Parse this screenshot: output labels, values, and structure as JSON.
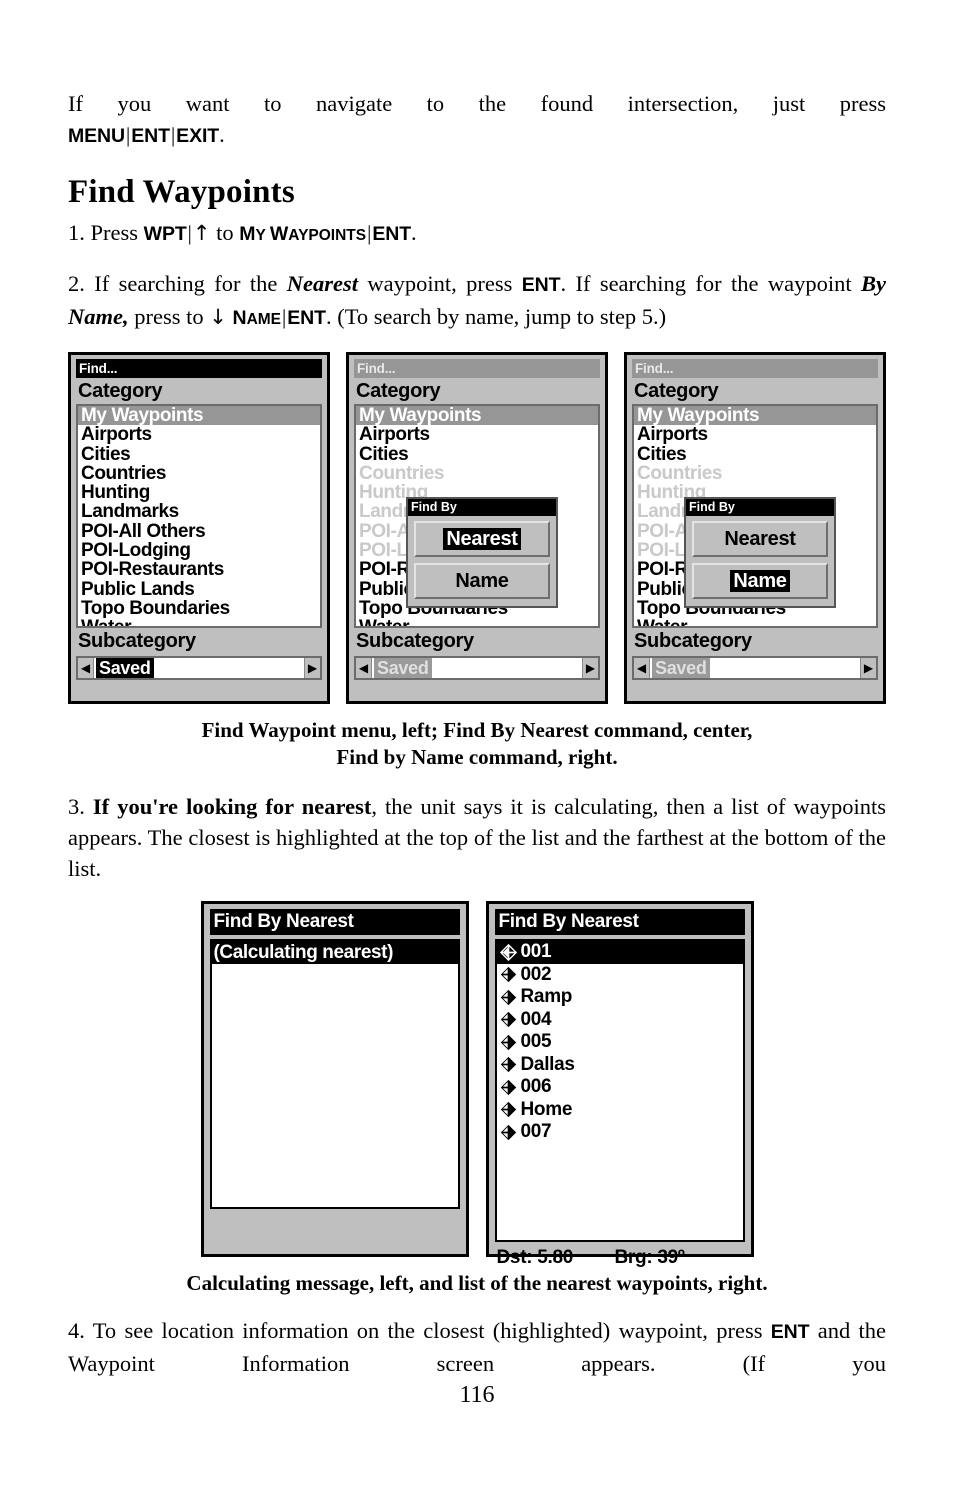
{
  "page": {
    "number": "116"
  },
  "intro": {
    "line_a": "If you want to navigate to the found intersection, just press",
    "key_menu": "MENU",
    "key_ent": "ENT",
    "key_exit": "EXIT",
    "sep": "|",
    "period": "."
  },
  "heading": "Find Waypoints",
  "step1": {
    "num": "1. Press",
    "key_wpt": "WPT",
    "arrow_up": "↑",
    "to": "to",
    "my_waypoints_cap": "M",
    "my_waypoints_rest": "Y ",
    "waypoints_cap": "W",
    "waypoints_rest": "AYPOINTS",
    "key_ent": "ENT",
    "period": "."
  },
  "step2": {
    "t1": "2. If searching for the ",
    "nearest": "Nearest",
    "t2": " waypoint, press ",
    "ent1": "ENT",
    "t3": ". If searching for the waypoint ",
    "byname": "By Name,",
    "t4": " press to ",
    "arrow_down": "↓",
    "name_cap": "N",
    "name_rest": "AME",
    "ent2": "ENT",
    "t5": ". (To search by name, jump to step 5.)"
  },
  "step3": {
    "num": "3. ",
    "bold": "If you're looking for nearest",
    "rest": ", the unit says it is calculating, then a list of waypoints appears. The closest is highlighted at the top of the list and the farthest at the bottom of the list."
  },
  "step4": {
    "t1": "4. To see location information on the closest (highlighted) waypoint, press ",
    "ent": "ENT",
    "t2": " and the Waypoint Information screen appears. (If you"
  },
  "caption1": {
    "line1": "Find Waypoint menu, left; Find By Nearest command, center,",
    "line2": "Find by Name command, right."
  },
  "caption2": "Calculating message, left, and list of the nearest waypoints, right.",
  "find_screen": {
    "title": "Find...",
    "category_label": "Category",
    "subcategory_label": "Subcategory",
    "subcategory_value": "Saved",
    "left_arrow": "◀",
    "right_arrow": "▶",
    "categories": [
      "My Waypoints",
      "Airports",
      "Cities",
      "Countries",
      "Hunting",
      "Landmarks",
      "POI-All Others",
      "POI-Lodging",
      "POI-Restaurants",
      "Public Lands",
      "Topo Boundaries",
      "Water"
    ],
    "selected_category": "My Waypoints"
  },
  "findby_dialog": {
    "title": "Find By",
    "options": [
      "Nearest",
      "Name"
    ],
    "selected_center": "Nearest",
    "selected_right": "Name"
  },
  "nearest_screen": {
    "title": "Find By Nearest",
    "calculating_message": "(Calculating nearest)",
    "waypoints": [
      "001",
      "002",
      "Ramp",
      "004",
      "005",
      "Dallas",
      "006",
      "Home",
      "007"
    ],
    "selected_waypoint": "001",
    "status": {
      "distance": "Dst: 5.80",
      "bearing": "Brg: 39º"
    },
    "waypoint_icon": "waypoint-diamond-icon"
  },
  "colors": {
    "screen_bg": "#bfbfbf",
    "list_bg": "#ffffff",
    "highlight_bg": "#969696",
    "title_bg": "#000000"
  }
}
